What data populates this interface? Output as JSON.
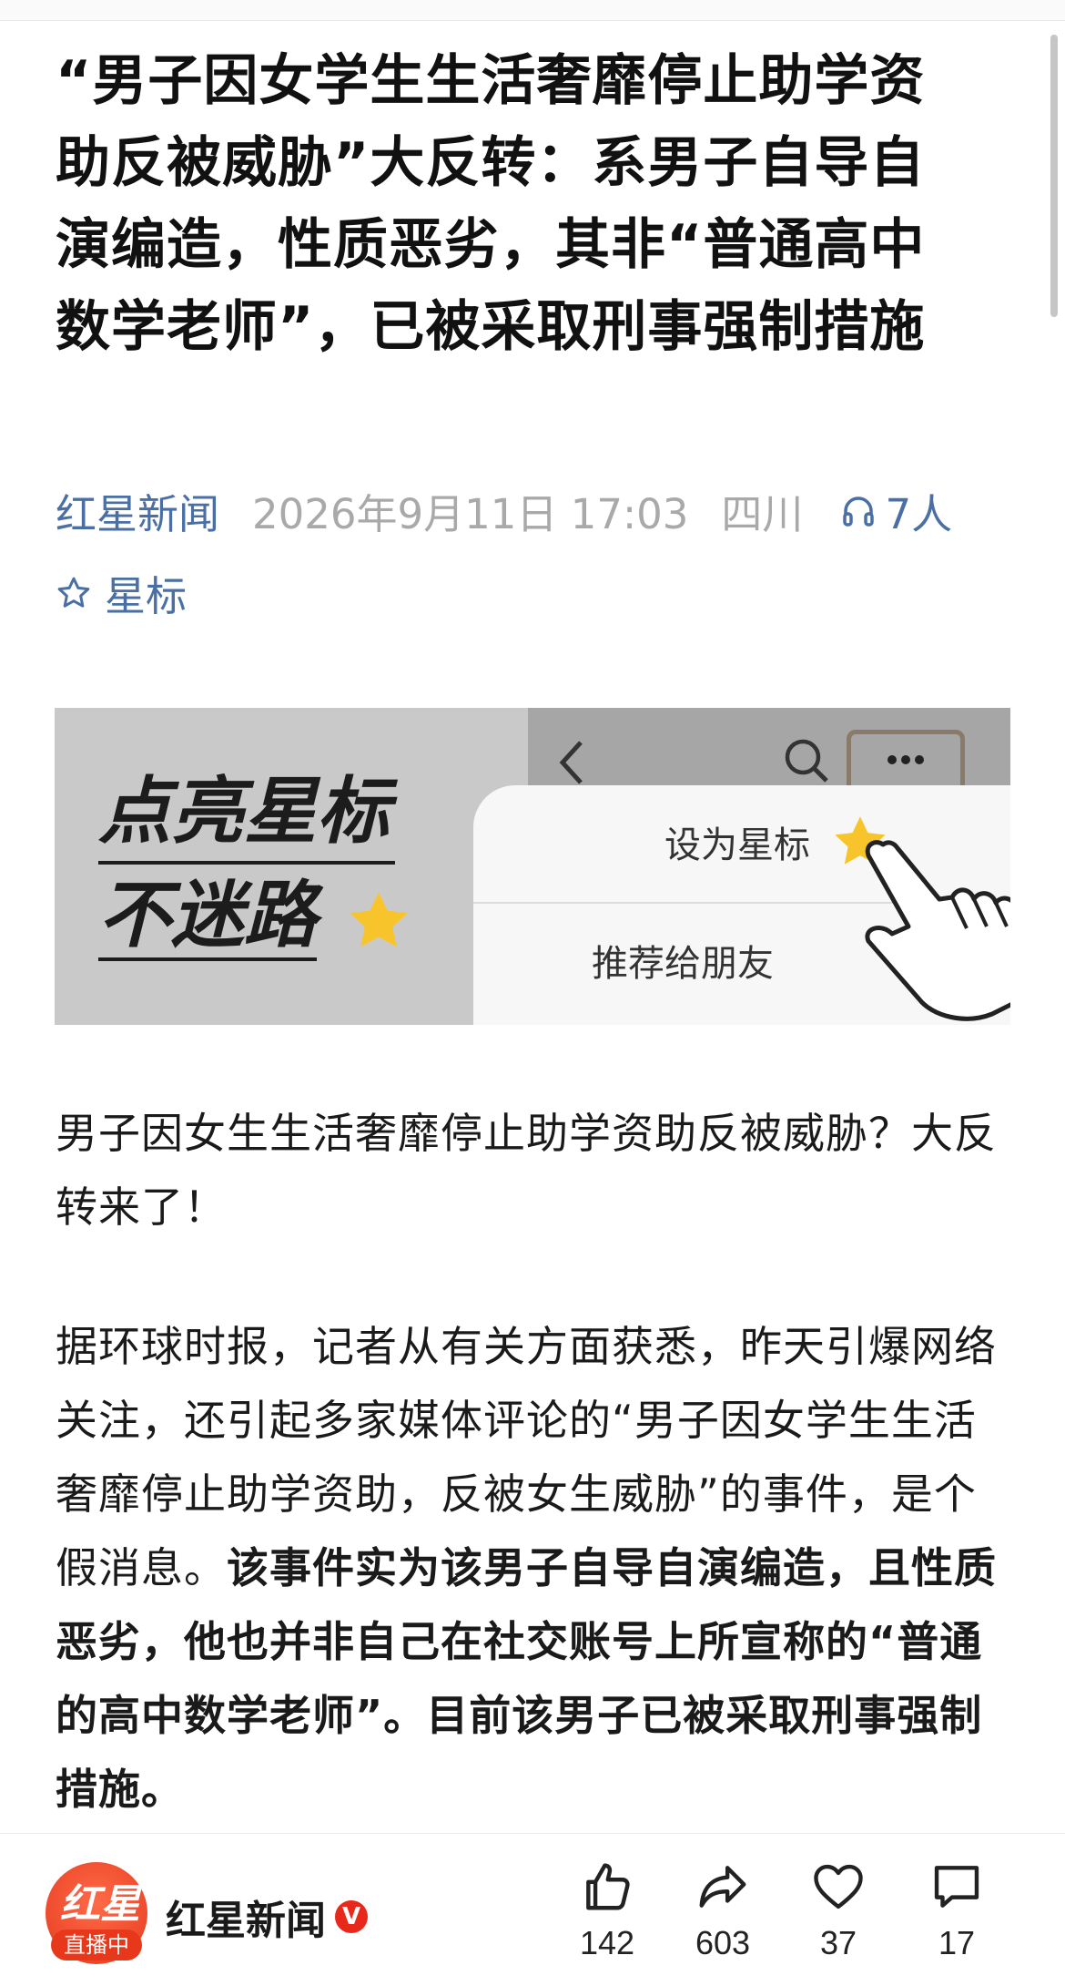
{
  "article": {
    "title": "“男子因女学生生活奢靡停止助学资助反被威胁”大反转：系男子自导自演编造，性质恶劣，其非“普通高中数学老师”，已被采取刑事强制措施",
    "source": "红星新闻",
    "date": "2026年9月11日 17:03",
    "region": "四川",
    "listeners": "7人",
    "star_label": "星标"
  },
  "banner": {
    "slogan_line1": "点亮星标",
    "slogan_line2": "不迷路",
    "set_star": "设为星标",
    "recommend": "推荐给朋友"
  },
  "body": {
    "p1": "男子因女生生活奢靡停止助学资助反被威胁？大反转来了！",
    "p2_normal": "据环球时报，记者从有关方面获悉，昨天引爆网络关注，还引起多家媒体评论的“男子因女学生生活奢靡停止助学资助，反被女生威胁”的事件，是个假消息。",
    "p2_bold": "该事件实为该男子自导自演编造，且性质恶劣，他也并非自己在社交账号上所宣称的“普通的高中数学老师”。目前该男子已被采取刑事强制措施。"
  },
  "bottom": {
    "avatar_logo": "红星",
    "live_label": "直播中",
    "author": "红星新闻",
    "verified_badge": "V",
    "likes": "142",
    "shares": "603",
    "favorites": "37",
    "comments": "17"
  },
  "colors": {
    "accent": "#4a6fa5",
    "meta_gray": "#a9a9a9",
    "brand_red": "#e8381c",
    "star_yellow": "#f7c52b"
  },
  "icons": [
    "headphones-icon",
    "star-outline-icon",
    "back-chevron-icon",
    "search-icon",
    "more-icon",
    "star-icon",
    "hand-pointer-icon",
    "thumbs-up-icon",
    "share-icon",
    "heart-icon",
    "comment-icon"
  ]
}
